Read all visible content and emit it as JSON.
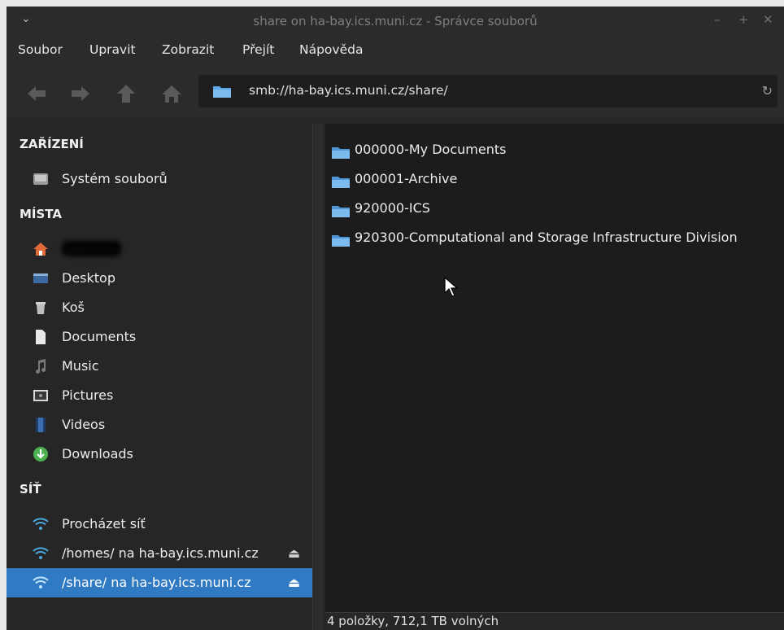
{
  "window": {
    "title": "share on ha-bay.ics.muni.cz - Správce souborů",
    "controls": {
      "minimize": "–",
      "maximize": "+",
      "close": "✕"
    }
  },
  "menubar": [
    "Soubor",
    "Upravit",
    "Zobrazit",
    "Přejít",
    "Nápověda"
  ],
  "toolbar": {
    "location": "smb://ha-bay.ics.muni.cz/share/"
  },
  "sidebar": {
    "devices": {
      "header": "ZAŘÍZENÍ",
      "items": [
        {
          "label": "Systém souborů",
          "icon": "drive-icon"
        }
      ]
    },
    "places": {
      "header": "MÍSTA",
      "items": [
        {
          "label": "gabriela",
          "icon": "home-icon",
          "blurred": true
        },
        {
          "label": "Desktop",
          "icon": "desktop-icon"
        },
        {
          "label": "Koš",
          "icon": "trash-icon"
        },
        {
          "label": "Documents",
          "icon": "document-icon"
        },
        {
          "label": "Music",
          "icon": "music-icon"
        },
        {
          "label": "Pictures",
          "icon": "picture-icon"
        },
        {
          "label": "Videos",
          "icon": "video-icon"
        },
        {
          "label": "Downloads",
          "icon": "download-icon"
        }
      ]
    },
    "network": {
      "header": "SÍŤ",
      "items": [
        {
          "label": "Procházet síť",
          "icon": "network-icon"
        },
        {
          "label": "/homes/ na ha-bay.ics.muni.cz",
          "icon": "network-icon",
          "eject": "⏏"
        },
        {
          "label": "/share/ na ha-bay.ics.muni.cz",
          "icon": "network-icon",
          "eject": "⏏",
          "selected": true
        }
      ]
    }
  },
  "files": [
    {
      "name": "000000-My Documents",
      "icon": "folder-icon"
    },
    {
      "name": "000001-Archive",
      "icon": "folder-icon"
    },
    {
      "name": "920000-ICS",
      "icon": "folder-icon"
    },
    {
      "name": "920300-Computational and Storage Infrastructure Division",
      "icon": "folder-icon"
    }
  ],
  "status": "4 položky, 712,1 TB volných",
  "colors": {
    "selection": "#2f7ac2",
    "folder": "#5aa6e6",
    "background": "#1c1c1c"
  }
}
